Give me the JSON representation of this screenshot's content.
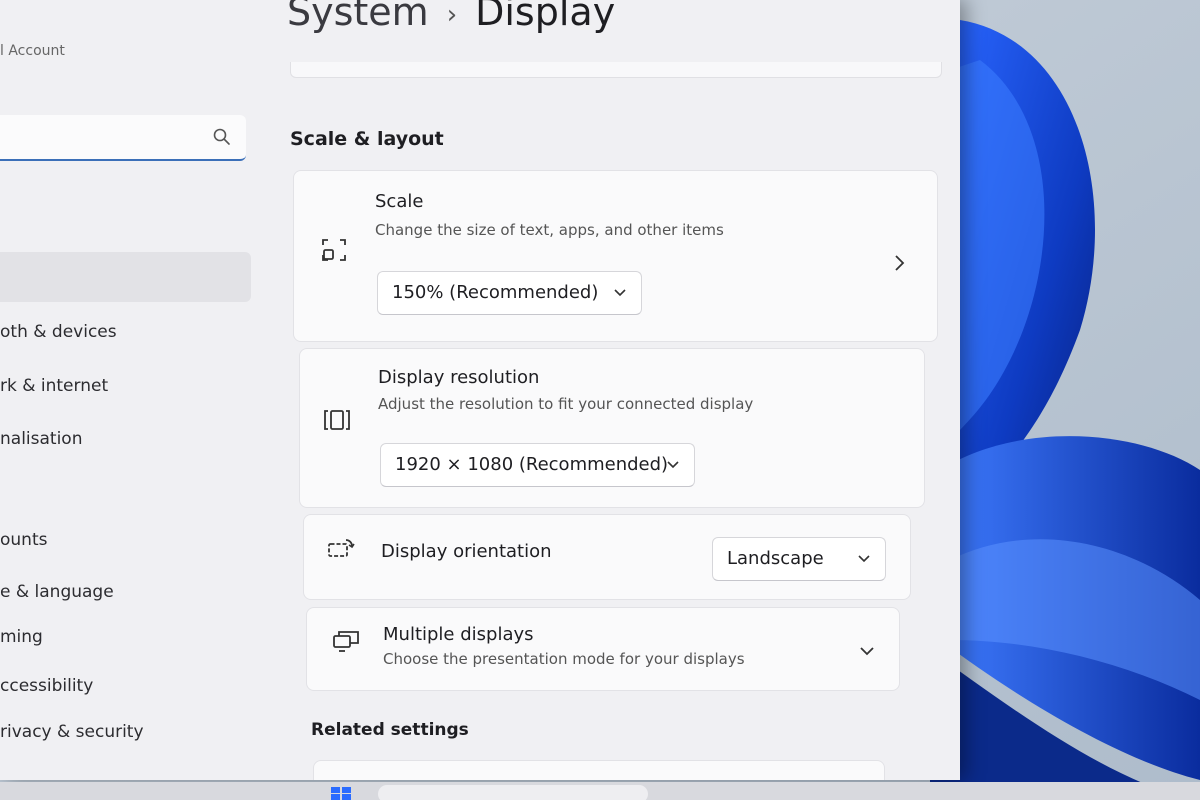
{
  "sidebar": {
    "account_label": "l Account",
    "items": [
      {
        "label": "oth & devices"
      },
      {
        "label": "rk & internet"
      },
      {
        "label": "nalisation"
      },
      {
        "label": "ounts"
      },
      {
        "label": "e & language"
      },
      {
        "label": "ming"
      },
      {
        "label": "ccessibility"
      },
      {
        "label": "rivacy & security"
      }
    ]
  },
  "breadcrumb": {
    "parent": "System",
    "separator": "›",
    "current": "Display"
  },
  "section": {
    "title": "Scale & layout"
  },
  "cards": {
    "scale": {
      "title": "Scale",
      "subtitle": "Change the size of text, apps, and other items",
      "value": "150% (Recommended)",
      "icon": "scale-icon"
    },
    "resolution": {
      "title": "Display resolution",
      "subtitle": "Adjust the resolution to fit your connected display",
      "value": "1920 × 1080 (Recommended)",
      "icon": "resolution-icon"
    },
    "orientation": {
      "title": "Display orientation",
      "value": "Landscape",
      "icon": "orientation-icon"
    },
    "multiple": {
      "title": "Multiple displays",
      "subtitle": "Choose the presentation mode for your displays",
      "icon": "multiple-displays-icon"
    }
  },
  "related": {
    "title": "Related settings"
  },
  "colors": {
    "accent": "#3b6fb8",
    "wallpaper_blue": "#1a4fd6"
  }
}
